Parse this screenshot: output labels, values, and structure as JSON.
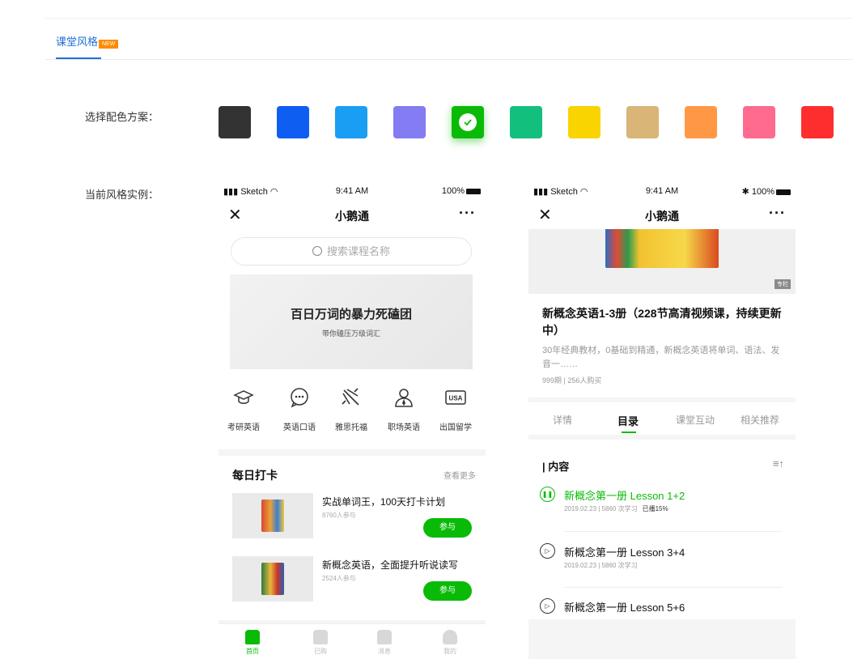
{
  "tabs": {
    "active_label": "课堂风格",
    "badge": "NEW"
  },
  "labels": {
    "color_scheme": "选择配色方案：",
    "current_style": "当前风格实例："
  },
  "color_swatches": [
    "#333333",
    "#0f5ef2",
    "#1a9ef3",
    "#837cf2",
    "#09bb07",
    "#13bf7d",
    "#f9d400",
    "#d9b577",
    "#ff9845",
    "#ff6a8f",
    "#ff2e2e"
  ],
  "selected_swatch_index": 4,
  "phone1": {
    "status": {
      "carrier": "Sketch",
      "time": "9:41 AM",
      "battery": "100%"
    },
    "nav": {
      "close": "✕",
      "title": "小鹅通",
      "more": "···"
    },
    "search_placeholder": "搜索课程名称",
    "banner": {
      "title": "百日万词的暴力死磕团",
      "subtitle": "带你磕压万级词汇"
    },
    "categories": [
      {
        "label": "考研英语",
        "icon": "graduation-cap-icon"
      },
      {
        "label": "英语口语",
        "icon": "chat-bubble-icon"
      },
      {
        "label": "雅思托福",
        "icon": "airplane-icon"
      },
      {
        "label": "职场英语",
        "icon": "person-tie-icon"
      },
      {
        "label": "出国留学",
        "icon": "usa-badge-icon",
        "badge_text": "USA"
      }
    ],
    "daily": {
      "title": "每日打卡",
      "more": "查看更多",
      "courses": [
        {
          "title": "实战单词王，100天打卡计划",
          "meta": "8760人参与",
          "button": "参与"
        },
        {
          "title": "新概念英语，全面提升听说读写",
          "meta": "2524人参与",
          "button": "参与"
        }
      ]
    },
    "bottom_tabs": [
      {
        "label": "首页",
        "icon": "home-icon"
      },
      {
        "label": "已购",
        "icon": "bag-icon"
      },
      {
        "label": "消息",
        "icon": "message-icon"
      },
      {
        "label": "我的",
        "icon": "user-icon"
      }
    ],
    "active_bottom_tab": 0
  },
  "phone2": {
    "status": {
      "carrier": "Sketch",
      "time": "9:41 AM",
      "battery": "100%",
      "bluetooth": "✱"
    },
    "nav": {
      "close": "✕",
      "title": "小鹅通",
      "more": "···"
    },
    "hero_tag": "专栏",
    "title": "新概念英语1-3册（228节高清视频课，持续更新中）",
    "desc": "30年经典教材，0基础到精通，新概念英语将单词、语法、发音一……",
    "meta": "999期 | 256人购买",
    "tabs": [
      "详情",
      "目录",
      "课堂互动",
      "相关推荐"
    ],
    "active_tab": 1,
    "list_title": "| 内容",
    "sort_icon": "≡↑",
    "lessons": [
      {
        "title": "新概念第一册 Lesson 1+2",
        "meta": "2019.02.23 | 5860 次学习",
        "played": "已播15%",
        "state": "playing"
      },
      {
        "title": "新概念第一册 Lesson 3+4",
        "meta": "2019.02.23 | 5860 次学习",
        "state": "paused"
      },
      {
        "title": "新概念第一册 Lesson 5+6",
        "meta": "",
        "state": "paused"
      }
    ]
  }
}
